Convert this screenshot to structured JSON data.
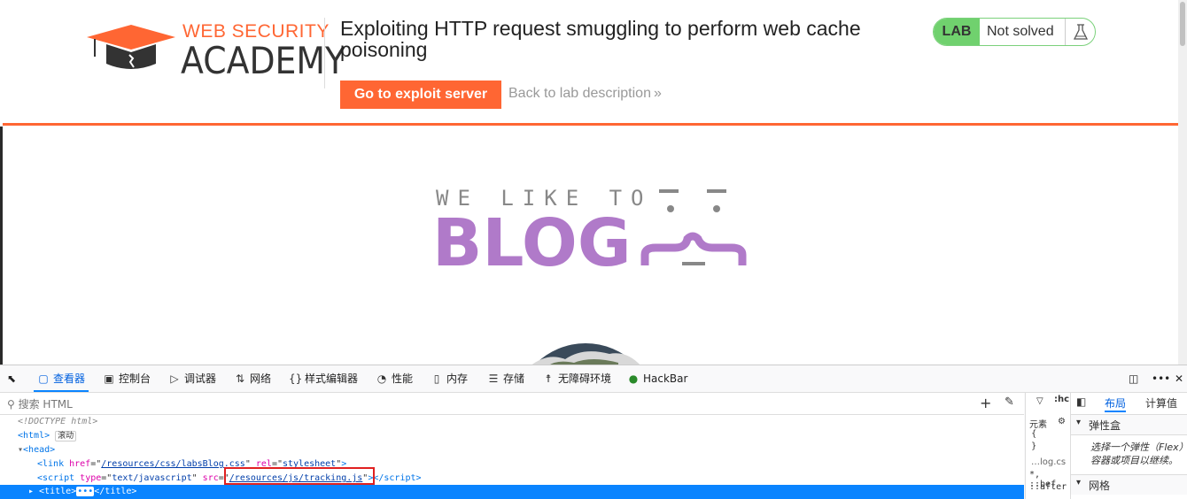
{
  "header": {
    "logo_line1": "WEB SECURITY",
    "logo_line2": "ACADEMY",
    "lab_title": "Exploiting HTTP request smuggling to perform web cache poisoning",
    "exploit_button": "Go to exploit server",
    "back_link": "Back to lab description",
    "status": {
      "badge": "LAB",
      "text": "Not solved"
    },
    "accent_color": "#ff6633",
    "status_color": "#70d16e"
  },
  "blog": {
    "tagline": "WE LIKE TO",
    "title": "BLOG",
    "title_color": "#b07ac9"
  },
  "devtools": {
    "tabs": [
      {
        "label": "查看器",
        "icon": "inspector-icon"
      },
      {
        "label": "控制台",
        "icon": "console-icon"
      },
      {
        "label": "调试器",
        "icon": "debugger-icon"
      },
      {
        "label": "网络",
        "icon": "network-icon"
      },
      {
        "label": "样式编辑器",
        "icon": "style-editor-icon"
      },
      {
        "label": "性能",
        "icon": "performance-icon"
      },
      {
        "label": "内存",
        "icon": "memory-icon"
      },
      {
        "label": "存储",
        "icon": "storage-icon"
      },
      {
        "label": "无障碍环境",
        "icon": "accessibility-icon"
      },
      {
        "label": "HackBar",
        "icon": "hackbar-icon"
      }
    ],
    "search_placeholder": "搜索 HTML",
    "tree": {
      "doctype": "<!DOCTYPE html>",
      "html_tag": "<html>",
      "scroll_badge": "滚动",
      "head_tag": "<head>",
      "link_href": "/resources/css/labsBlog.css",
      "link_rel": "stylesheet",
      "script_type": "text/javascript",
      "script_src": "/resources/js/tracking.js",
      "title_line": "<title>",
      "title_close": "</title>"
    },
    "rules_panel": {
      "label": "元素",
      "brace_open": "{",
      "brace_close": "}",
      "file": "…log.cs",
      "sel1": "*, ::bef",
      "sel2": "::after"
    },
    "layout_panel": {
      "tab_layout": "布局",
      "tab_computed": "计算值",
      "flexbox_header": "弹性盒",
      "flexbox_text": "选择一个弹性（Flex）容器或项目以继续。",
      "grid_header": "网格",
      "hc_label": ":hc"
    }
  }
}
